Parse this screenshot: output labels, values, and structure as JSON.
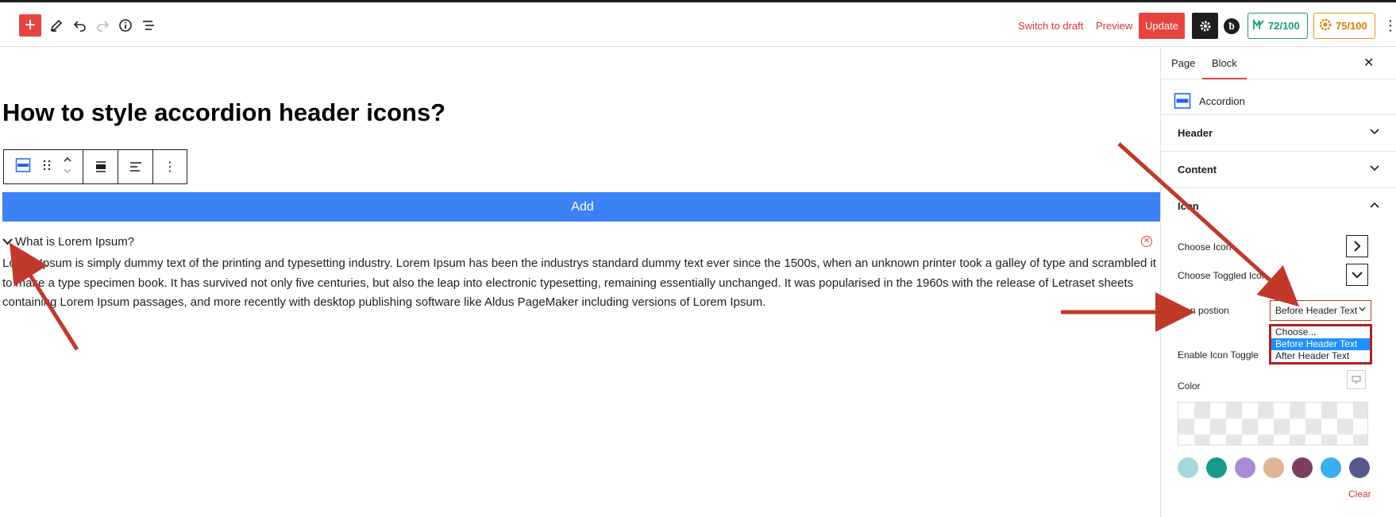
{
  "toolbar": {
    "switch_to_draft": "Switch to draft",
    "preview": "Preview",
    "update": "Update",
    "score_1": "72/100",
    "score_2": "75/100"
  },
  "editor": {
    "title": "How to style accordion header icons?",
    "add_label": "Add",
    "accordion_header": "What is Lorem Ipsum?",
    "accordion_body": "Lorem Ipsum is simply dummy text of the printing and typesetting industry. Lorem Ipsum has been the industrys standard dummy text ever since the 1500s, when an unknown printer took a galley of type and scrambled it to make a type specimen book. It has survived not only five centuries, but also the leap into electronic typesetting, remaining essentially unchanged. It was popularised in the 1960s with the release of Letraset sheets containing Lorem Ipsum passages, and more recently with desktop publishing software like Aldus PageMaker including versions of Lorem Ipsum."
  },
  "sidebar": {
    "tabs": [
      "Page",
      "Block"
    ],
    "active_tab": "Block",
    "block_name": "Accordion",
    "panels": {
      "header": "Header",
      "content": "Content",
      "icon": "Icon"
    },
    "fields": {
      "choose_icon": "Choose Icon",
      "choose_toggled_icon": "Choose Toggled Icon",
      "icon_position": "Icon postion",
      "enable_icon_toggle": "Enable Icon Toggle",
      "color": "Color",
      "clear": "Clear"
    },
    "icon_position_select": {
      "value": "Before Header Text",
      "options": [
        "Choose...",
        "Before Header Text",
        "After Header Text"
      ]
    },
    "swatches": [
      "#a3d9e0",
      "#17998e",
      "#a98bd6",
      "#dcb596",
      "#7a3e62",
      "#3aaef0",
      "#555a8c"
    ]
  },
  "colors": {
    "accent": "#e5443f",
    "blue_bar": "#3b82f6",
    "annotation": "#c0392b"
  }
}
